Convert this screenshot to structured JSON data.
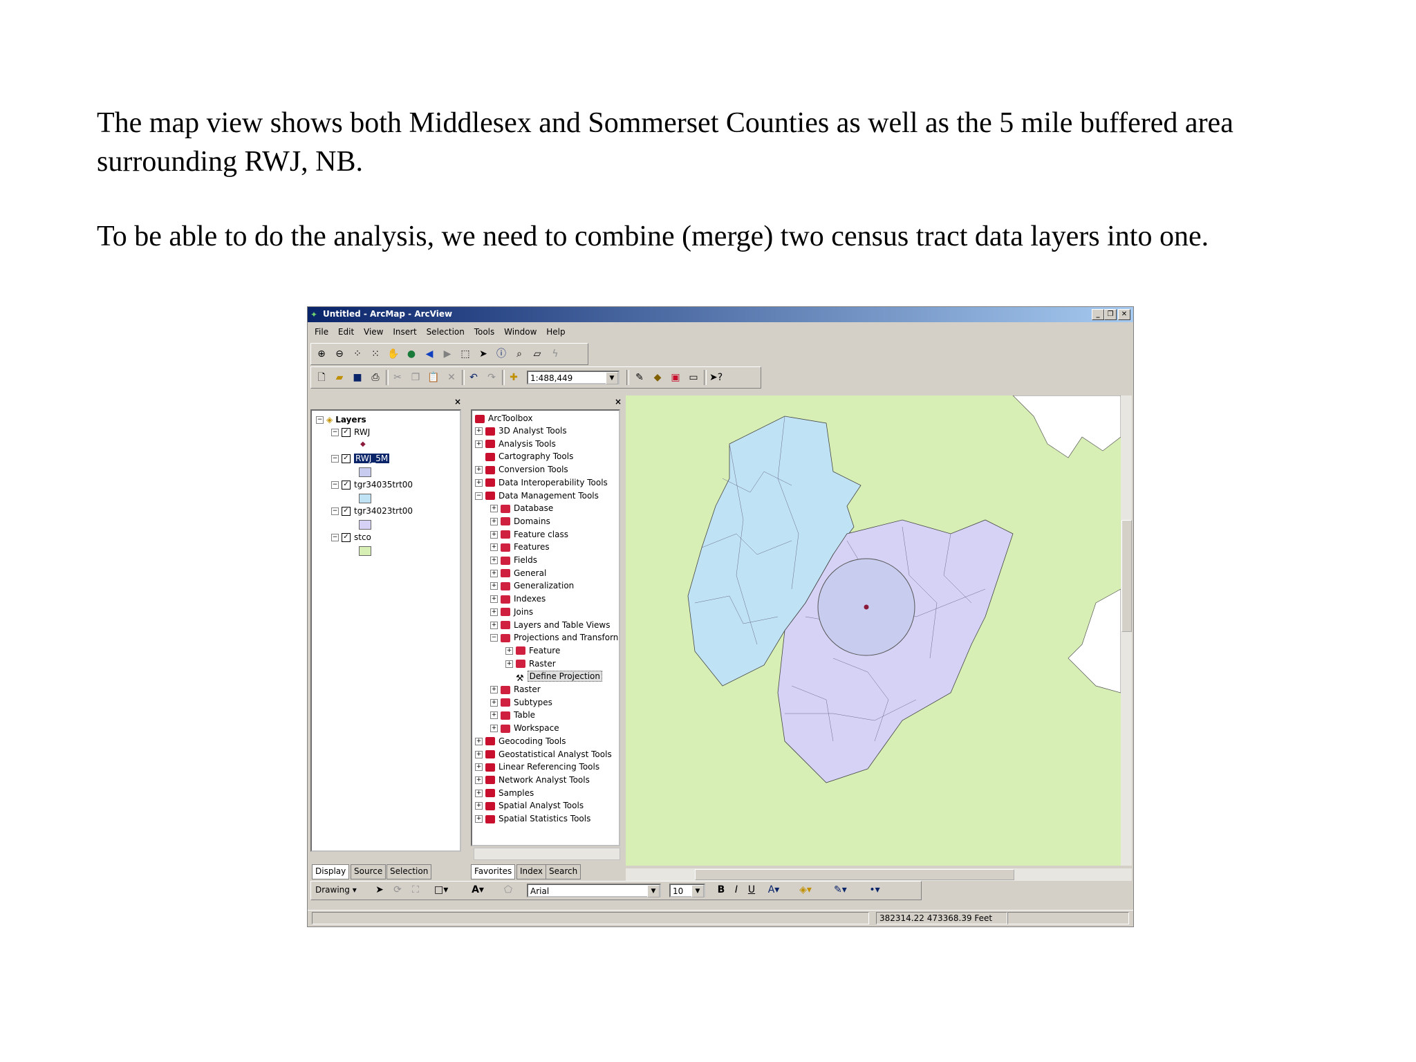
{
  "document": {
    "paragraph1": "The map view shows both Middlesex and Sommerset Counties as well as the 5 mile buffered area surrounding RWJ, NB.",
    "paragraph2": "To be able to do the analysis, we need to combine (merge) two census tract data layers into one."
  },
  "window": {
    "title": "Untitled - ArcMap - ArcView",
    "controls": [
      "_",
      "❐",
      "✕"
    ]
  },
  "menu": [
    "File",
    "Edit",
    "View",
    "Insert",
    "Selection",
    "Tools",
    "Window",
    "Help"
  ],
  "toolbar": {
    "scale": "1:488,449"
  },
  "toc": {
    "root": "Layers",
    "layers": [
      {
        "name": "RWJ",
        "checked": true,
        "symbol": "point",
        "color": "#8b1a3a"
      },
      {
        "name": "RWJ_5M",
        "checked": true,
        "selected": true,
        "color": "#c8cdf0"
      },
      {
        "name": "tgr34035trt00",
        "checked": true,
        "color": "#bfe2f5"
      },
      {
        "name": "tgr34023trt00",
        "checked": true,
        "color": "#d6d2f6"
      },
      {
        "name": "stco",
        "checked": true,
        "color": "#d7efb4"
      }
    ],
    "tabs": [
      "Display",
      "Source",
      "Selection"
    ]
  },
  "toolbox": {
    "root": "ArcToolbox",
    "items": [
      {
        "label": "3D Analyst Tools",
        "level": 1,
        "exp": "+"
      },
      {
        "label": "Analysis Tools",
        "level": 1,
        "exp": "+"
      },
      {
        "label": "Cartography Tools",
        "level": 1,
        "exp": ""
      },
      {
        "label": "Conversion Tools",
        "level": 1,
        "exp": "+"
      },
      {
        "label": "Data Interoperability Tools",
        "level": 1,
        "exp": "+"
      },
      {
        "label": "Data Management Tools",
        "level": 1,
        "exp": "−"
      },
      {
        "label": "Database",
        "level": 2,
        "exp": "+"
      },
      {
        "label": "Domains",
        "level": 2,
        "exp": "+"
      },
      {
        "label": "Feature class",
        "level": 2,
        "exp": "+"
      },
      {
        "label": "Features",
        "level": 2,
        "exp": "+"
      },
      {
        "label": "Fields",
        "level": 2,
        "exp": "+"
      },
      {
        "label": "General",
        "level": 2,
        "exp": "+"
      },
      {
        "label": "Generalization",
        "level": 2,
        "exp": "+"
      },
      {
        "label": "Indexes",
        "level": 2,
        "exp": "+"
      },
      {
        "label": "Joins",
        "level": 2,
        "exp": "+"
      },
      {
        "label": "Layers and Table Views",
        "level": 2,
        "exp": "+"
      },
      {
        "label": "Projections and Transforn",
        "level": 2,
        "exp": "−"
      },
      {
        "label": "Feature",
        "level": 3,
        "exp": "+"
      },
      {
        "label": "Raster",
        "level": 3,
        "exp": "+"
      },
      {
        "label": "Define Projection",
        "level": 3,
        "exp": "",
        "tool": true
      },
      {
        "label": "Raster",
        "level": 2,
        "exp": "+"
      },
      {
        "label": "Subtypes",
        "level": 2,
        "exp": "+"
      },
      {
        "label": "Table",
        "level": 2,
        "exp": "+"
      },
      {
        "label": "Workspace",
        "level": 2,
        "exp": "+"
      },
      {
        "label": "Geocoding Tools",
        "level": 1,
        "exp": "+"
      },
      {
        "label": "Geostatistical Analyst Tools",
        "level": 1,
        "exp": "+"
      },
      {
        "label": "Linear Referencing Tools",
        "level": 1,
        "exp": "+"
      },
      {
        "label": "Network Analyst Tools",
        "level": 1,
        "exp": "+"
      },
      {
        "label": "Samples",
        "level": 1,
        "exp": "+"
      },
      {
        "label": "Spatial Analyst Tools",
        "level": 1,
        "exp": "+"
      },
      {
        "label": "Spatial Statistics Tools",
        "level": 1,
        "exp": "+"
      }
    ],
    "tabs": [
      "Favorites",
      "Index",
      "Search"
    ]
  },
  "drawing": {
    "label": "Drawing",
    "font": "Arial",
    "size": "10",
    "bold": "B",
    "italic": "I",
    "underline": "U"
  },
  "status": {
    "coords": "382314.22  473368.39 Feet"
  },
  "colors": {
    "background_county": "#d7efb4",
    "middlesex": "#d6d2f6",
    "somerset": "#bfe2f5",
    "buffer": "#c8cdf0",
    "point": "#8b1a3a"
  }
}
